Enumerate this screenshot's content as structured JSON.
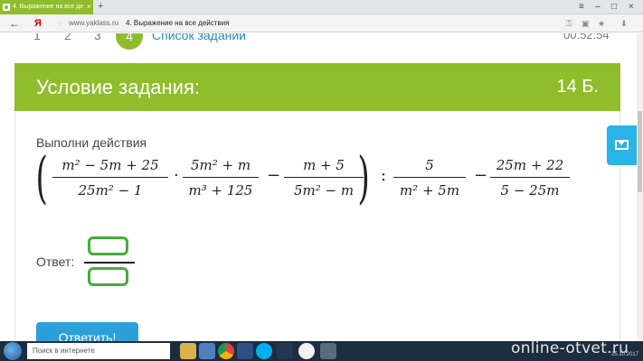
{
  "browser": {
    "tab_title": "4. Выражение на все де",
    "tab_close": "×",
    "new_tab": "+",
    "back": "←",
    "yandex_logo": "Я",
    "url": "www.yaklass.ru",
    "page_title": "4. Выражение на все действия",
    "window_controls": [
      "≡",
      "–",
      "□",
      "×"
    ]
  },
  "progress": {
    "steps": [
      "1",
      "2",
      "3"
    ],
    "current_step": "4",
    "task_list_label": "Список заданий",
    "timer": "00:52:54"
  },
  "task": {
    "title": "Условие задания:",
    "points": "14 Б.",
    "instruction": "Выполни действия",
    "expression": {
      "left_paren": "(",
      "right_paren": ")",
      "f1": {
        "num": "m² − 5m + 25",
        "den": "25m² − 1"
      },
      "op1": "·",
      "f2": {
        "num": "5m² + m",
        "den": "m³ + 125"
      },
      "op2": "−",
      "f3": {
        "num": "m + 5",
        "den": "5m² − m"
      },
      "op3": ":",
      "f4": {
        "num": "5",
        "den": "m² + 5m"
      },
      "op4": "−",
      "f5": {
        "num": "25m + 22",
        "den": "5 − 25m"
      }
    },
    "answer_label": "Ответ:",
    "submit_label": "Ответить!"
  },
  "taskbar": {
    "search_placeholder": "Поиск в интернете",
    "watermark": "online-otvet.ru",
    "date": "25.10.2017"
  },
  "colors": {
    "brand_green": "#8fbd2c",
    "answer_border": "#46ad3c",
    "button_blue": "#2a9fd8"
  }
}
